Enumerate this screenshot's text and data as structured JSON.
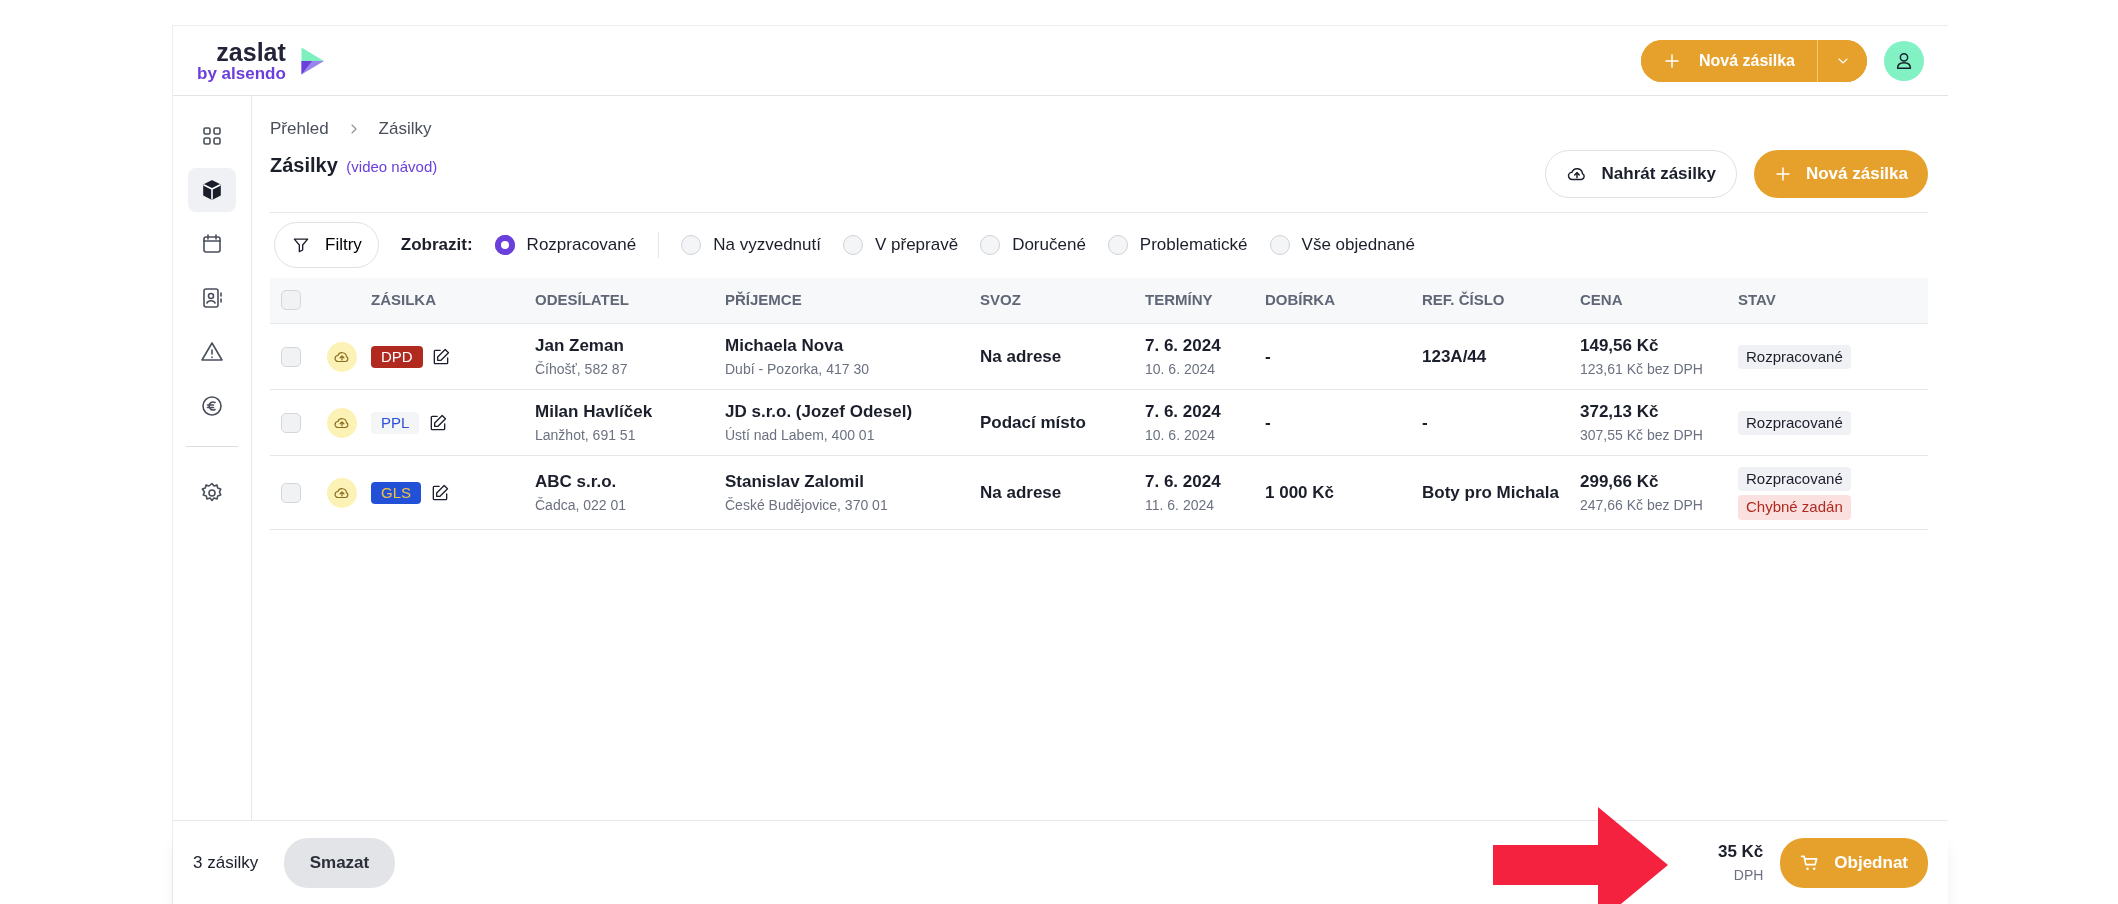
{
  "logo": {
    "name": "zaslat",
    "tagline": "by alsendo"
  },
  "header": {
    "new_button": "Nová zásilka"
  },
  "sidebar": {
    "items": [
      {
        "kind": "grid",
        "selected": false
      },
      {
        "kind": "box",
        "selected": true
      },
      {
        "kind": "calendar",
        "selected": false
      },
      {
        "kind": "contacts",
        "selected": false
      },
      {
        "kind": "warning",
        "selected": false
      },
      {
        "kind": "euro",
        "selected": false
      },
      {
        "kind": "settings",
        "selected": false
      }
    ]
  },
  "breadcrumb": [
    "Přehled",
    "Zásilky"
  ],
  "page": {
    "title": "Zásilky",
    "video_link": "(video návod)",
    "upload_button": "Nahrát zásilky",
    "new_button": "Nová zásilka"
  },
  "filters": {
    "button": "Filtry",
    "label": "Zobrazit:",
    "options": [
      {
        "label": "Rozpracované",
        "selected": true
      },
      {
        "label": "Na vyzvednutí",
        "selected": false
      },
      {
        "label": "V přepravě",
        "selected": false
      },
      {
        "label": "Doručené",
        "selected": false
      },
      {
        "label": "Problematické",
        "selected": false
      },
      {
        "label": "Vše objednané",
        "selected": false
      }
    ]
  },
  "table": {
    "select_all": {
      "checked": false
    },
    "columns": [
      "ZÁSILKA",
      "ODESÍLATEL",
      "PŘÍJEMCE",
      "SVOZ",
      "TERMÍNY",
      "DOBÍRKA",
      "REF. ČÍSLO",
      "CENA",
      "STAV"
    ],
    "rows": [
      {
        "checked": false,
        "carrier": {
          "label": "DPD",
          "kind": "dpd"
        },
        "sender": {
          "name": "Jan Zeman",
          "address": "Číhošť, 582 87"
        },
        "recipient": {
          "name": "Michaela Nova",
          "address": "Dubí - Pozorka, 417 30"
        },
        "pickup": "Na adrese",
        "date_from": "7. 6. 2024",
        "date_to": "10. 6. 2024",
        "cod": "-",
        "ref": "123A/44",
        "price": "149,56 Kč",
        "price_net": "123,61 Kč bez DPH",
        "statuses": [
          {
            "label": "Rozpracované",
            "kind": "draft"
          }
        ]
      },
      {
        "checked": false,
        "carrier": {
          "label": "PPL",
          "kind": "ppl"
        },
        "sender": {
          "name": "Milan Havlíček",
          "address": "Lanžhot, 691 51"
        },
        "recipient": {
          "name": "JD s.r.o. (Jozef Odesel)",
          "address": "Ústí nad Labem, 400 01"
        },
        "pickup": "Podací místo",
        "date_from": "7. 6. 2024",
        "date_to": "10. 6. 2024",
        "cod": "-",
        "ref": "-",
        "price": "372,13 Kč",
        "price_net": "307,55 Kč bez DPH",
        "statuses": [
          {
            "label": "Rozpracované",
            "kind": "draft"
          }
        ]
      },
      {
        "checked": false,
        "carrier": {
          "label": "GLS",
          "kind": "gls"
        },
        "sender": {
          "name": "ABC s.r.o.",
          "address": "Čadca, 022 01"
        },
        "recipient": {
          "name": "Stanislav Zalomil",
          "address": "České Budějovice, 370 01"
        },
        "pickup": "Na adrese",
        "date_from": "7. 6. 2024",
        "date_to": "11. 6. 2024",
        "cod": "1 000 Kč",
        "ref": "Boty pro Michala",
        "price": "299,66 Kč",
        "price_net": "247,66 Kč bez DPH",
        "statuses": [
          {
            "label": "Rozpracované",
            "kind": "draft"
          },
          {
            "label": "Chybné zadán",
            "kind": "error"
          }
        ]
      }
    ]
  },
  "footer": {
    "count": "3 zásilky",
    "delete_button": "Smazat",
    "total": "35 Kč",
    "total_net": "DPH",
    "order_button": "Objednat"
  }
}
